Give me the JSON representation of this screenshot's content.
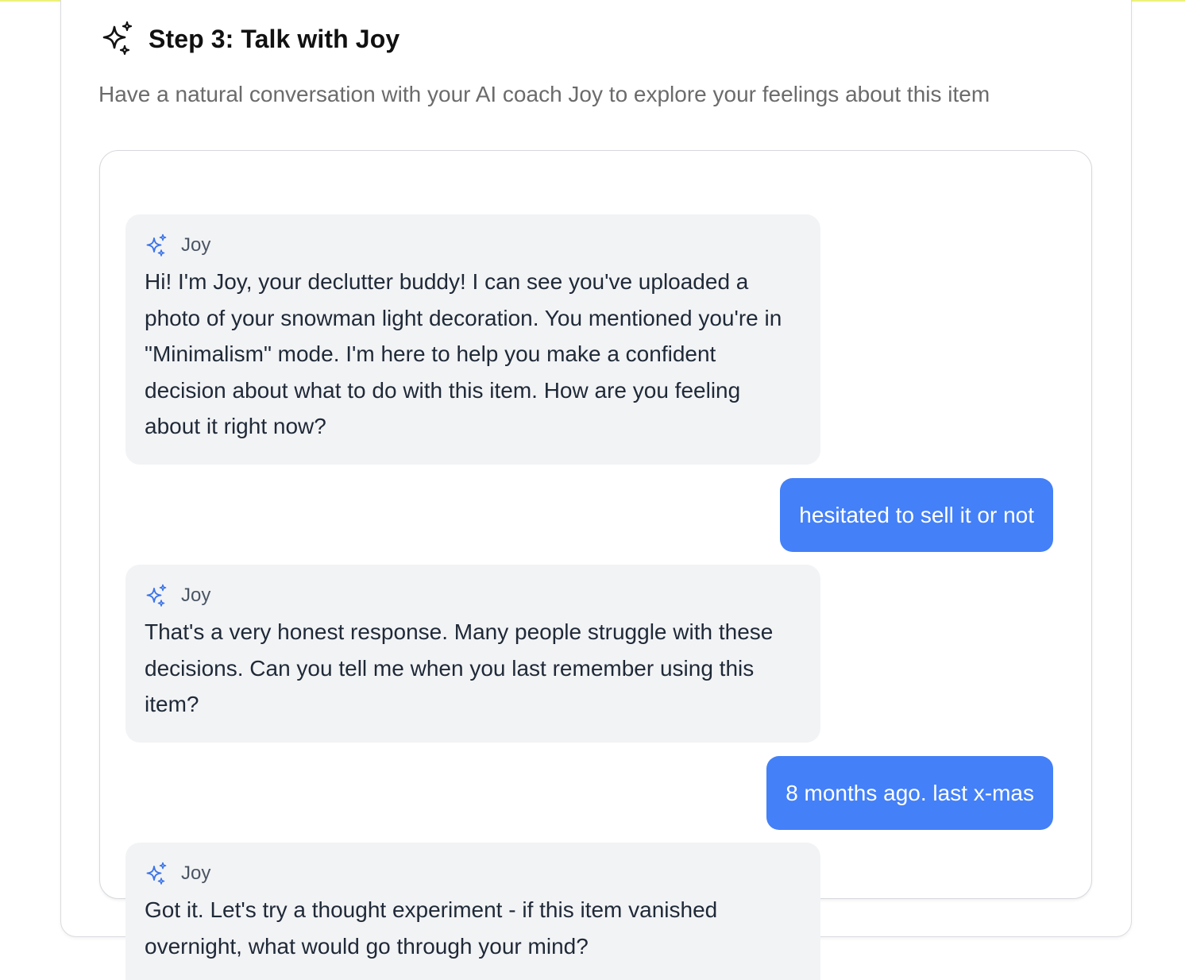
{
  "step": {
    "icon": "sparkles-icon",
    "title": "Step 3: Talk with Joy",
    "subtitle": "Have a natural conversation with your AI coach Joy to explore your feelings about this item"
  },
  "chat": {
    "messages": [
      {
        "role": "assistant",
        "sender": "Joy",
        "icon": "sparkles-icon",
        "text": "Hi! I'm Joy, your declutter buddy! I can see you've uploaded a photo of your snowman light decoration. You mentioned you're in \"Minimalism\" mode. I'm here to help you make a confident decision about what to do with this item. How are you feeling about it right now?"
      },
      {
        "role": "user",
        "text": "hesitated to sell it or not"
      },
      {
        "role": "assistant",
        "sender": "Joy",
        "icon": "sparkles-icon",
        "text": "That's a very honest response. Many people struggle with these decisions. Can you tell me when you last remember using this item?"
      },
      {
        "role": "user",
        "text": "8 months ago. last x-mas"
      },
      {
        "role": "assistant",
        "sender": "Joy",
        "icon": "sparkles-icon",
        "text": "Got it. Let's try a thought experiment - if this item vanished overnight, what would go through your mind?"
      }
    ]
  },
  "colors": {
    "accent_top": "#eef27a",
    "user_bubble": "#4480f7",
    "bot_bubble": "#f2f3f5",
    "bot_icon": "#3b74e8"
  }
}
